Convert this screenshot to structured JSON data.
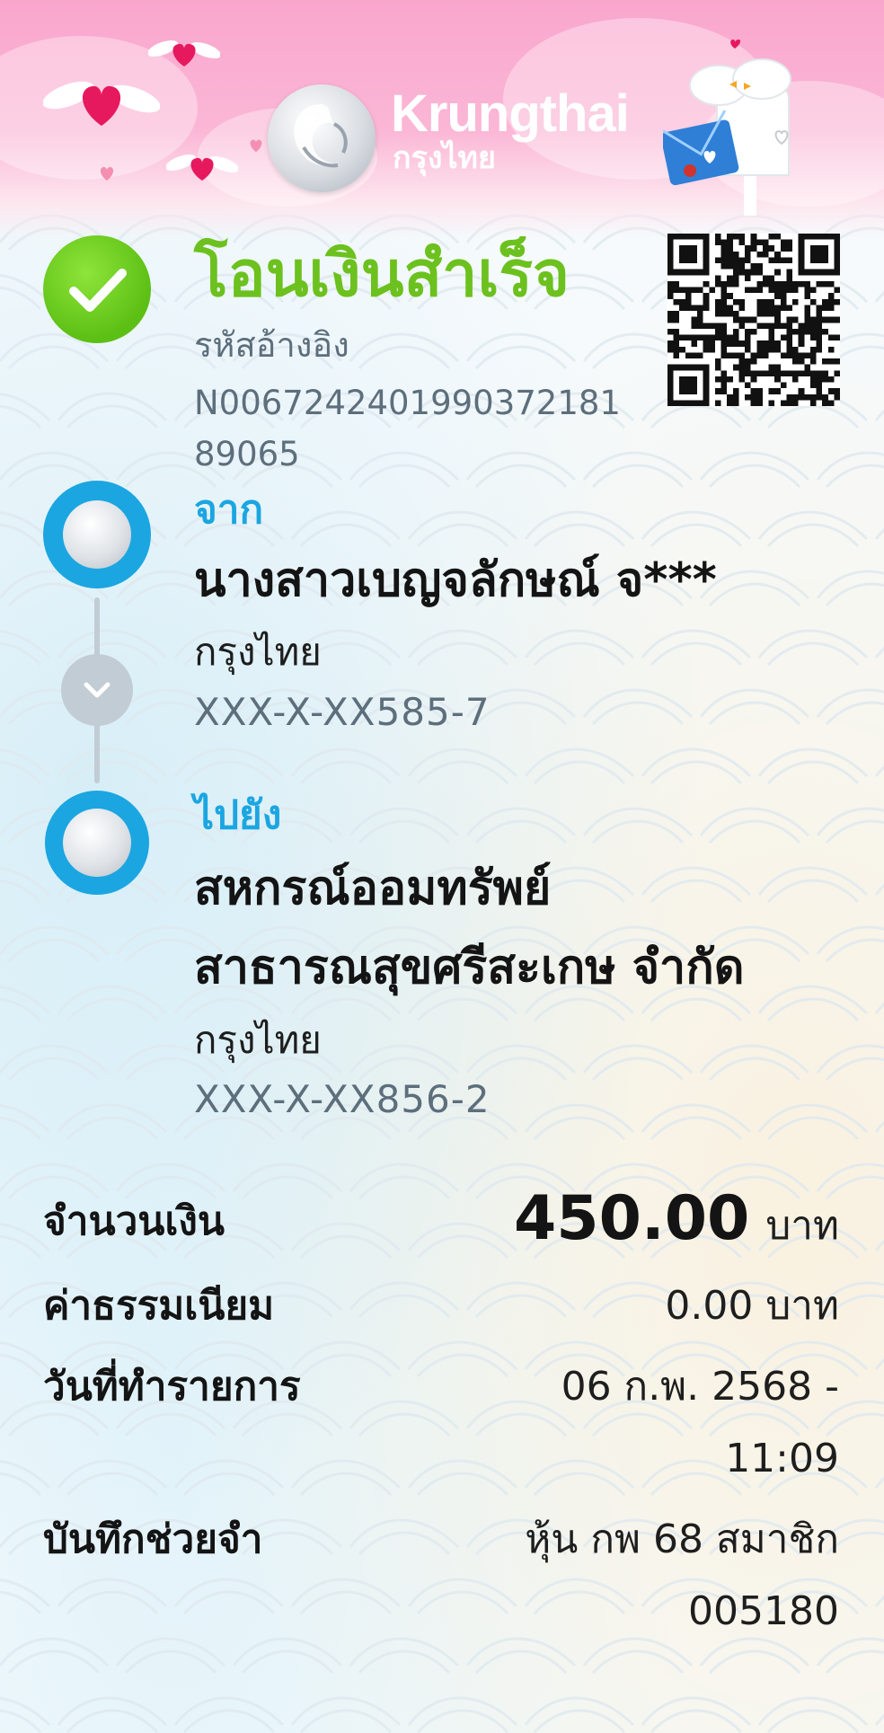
{
  "header": {
    "logo_en": "Krungthai",
    "logo_th": "กรุงไทย"
  },
  "status": {
    "title": "โอนเงินสำเร็จ",
    "ref_label": "รหัสอ้างอิง",
    "ref_value": "N006724240199037218189065"
  },
  "from": {
    "label": "จาก",
    "name": "นางสาวเบญจลักษณ์ จ***",
    "bank": "กรุงไทย",
    "account": "XXX-X-XX585-7"
  },
  "to": {
    "label": "ไปยัง",
    "name_line1": "สหกรณ์ออมทรัพย์",
    "name_line2": "สาธารณสุขศรีสะเกษ จำกัด",
    "bank": "กรุงไทย",
    "account": "XXX-X-XX856-2"
  },
  "details": {
    "amount_label": "จำนวนเงิน",
    "amount_value": "450.00",
    "amount_unit": "บาท",
    "fee_label": "ค่าธรรมเนียม",
    "fee_value": "0.00 บาท",
    "date_label": "วันที่ทำรายการ",
    "date_line1": "06 ก.พ. 2568 -",
    "date_line2": "11:09",
    "memo_label": "บันทึกช่วยจำ",
    "memo_line1": "หุ้น กพ 68 สมาชิก",
    "memo_line2": "005180"
  },
  "colors": {
    "success_green": "#6cc11e",
    "krungthai_blue": "#1ba6e1",
    "muted_text": "#5d6e7c"
  }
}
